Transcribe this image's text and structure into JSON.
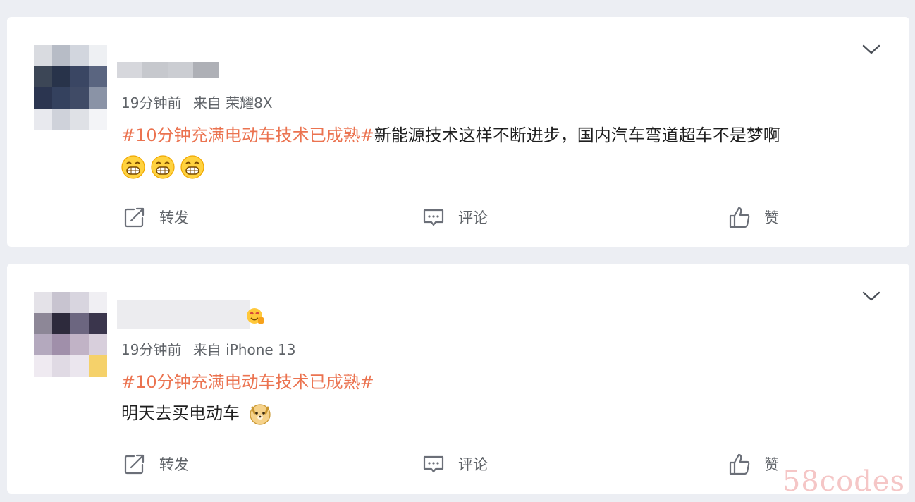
{
  "posts": [
    {
      "meta": {
        "time": "19分钟前",
        "source": "来自 荣耀8X"
      },
      "topic": "#10分钟充满电动车技术已成熟#",
      "text": "新能源技术这样不断进步，国内汽车弯道超车不是梦啊",
      "emojis": [
        "grinning-face-icon",
        "grinning-face-icon",
        "grinning-face-icon"
      ],
      "actions": {
        "repost": "转发",
        "comment": "评论",
        "like": "赞"
      }
    },
    {
      "meta": {
        "time": "19分钟前",
        "source": "来自 iPhone 13"
      },
      "topic": "#10分钟充满电动车技术已成熟#",
      "text": "明天去买电动车",
      "emojis": [
        "doge-icon"
      ],
      "actions": {
        "repost": "转发",
        "comment": "评论",
        "like": "赞"
      }
    }
  ],
  "watermark": "58codes",
  "colors": {
    "topic": "#eb7350",
    "text": "#1f1f1f",
    "meta": "#5f6368",
    "background": "#eceef3"
  }
}
